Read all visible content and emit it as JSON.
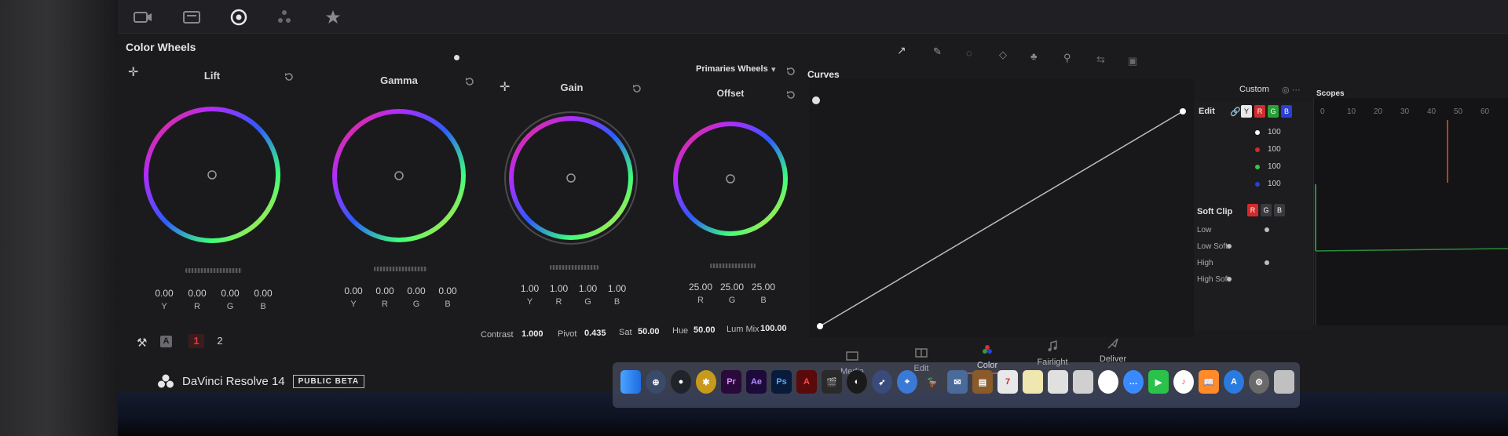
{
  "color_wheels": {
    "title": "Color Wheels",
    "mode": "Primaries Wheels",
    "wheels": [
      {
        "name": "Lift",
        "values": [
          "0.00",
          "0.00",
          "0.00",
          "0.00"
        ],
        "channels": [
          "Y",
          "R",
          "G",
          "B"
        ]
      },
      {
        "name": "Gamma",
        "values": [
          "0.00",
          "0.00",
          "0.00",
          "0.00"
        ],
        "channels": [
          "Y",
          "R",
          "G",
          "B"
        ]
      },
      {
        "name": "Gain",
        "values": [
          "1.00",
          "1.00",
          "1.00",
          "1.00"
        ],
        "channels": [
          "Y",
          "R",
          "G",
          "B"
        ]
      },
      {
        "name": "Offset",
        "values": [
          "25.00",
          "25.00",
          "25.00"
        ],
        "channels": [
          "R",
          "G",
          "B"
        ]
      }
    ],
    "bottom": {
      "a_label": "A",
      "page_1": "1",
      "page_2": "2",
      "contrast_label": "Contrast",
      "contrast_value": "1.000",
      "pivot_label": "Pivot",
      "pivot_value": "0.435",
      "sat_label": "Sat",
      "sat_value": "50.00",
      "hue_label": "Hue",
      "hue_value": "50.00",
      "lummix_label": "Lum Mix",
      "lummix_value": "100.00"
    }
  },
  "curves": {
    "title": "Curves",
    "mode": "Custom",
    "edit_label": "Edit",
    "edit_values": [
      "100",
      "100",
      "100",
      "100"
    ],
    "channel_buttons": [
      "Y",
      "R",
      "G",
      "B"
    ],
    "soft_clip_label": "Soft Clip",
    "soft_clip_rows": [
      "Low",
      "Low Soft",
      "High",
      "High Soft"
    ]
  },
  "scopes": {
    "title": "Scopes",
    "ticks": [
      "0",
      "10",
      "20",
      "30",
      "40",
      "50",
      "60"
    ]
  },
  "pages": [
    {
      "label": "Media"
    },
    {
      "label": "Edit"
    },
    {
      "label": "Color"
    },
    {
      "label": "Fairlight"
    },
    {
      "label": "Deliver"
    }
  ],
  "brand": {
    "name": "DaVinci Resolve 14",
    "badge": "PUBLIC BETA"
  },
  "dock": {
    "icons": [
      {
        "name": "finder",
        "text": ""
      },
      {
        "name": "launchpad",
        "text": ""
      },
      {
        "name": "resolve",
        "text": ""
      },
      {
        "name": "fusion",
        "text": ""
      },
      {
        "name": "premiere",
        "text": "Pr"
      },
      {
        "name": "aftereffects",
        "text": "Ae"
      },
      {
        "name": "photoshop",
        "text": "Ps"
      },
      {
        "name": "acrobat",
        "text": ""
      }
    ]
  },
  "colors": {
    "accent_red": "#d22b2b",
    "panel_bg": "#1b1b1e",
    "active_page": "#d0342c"
  }
}
